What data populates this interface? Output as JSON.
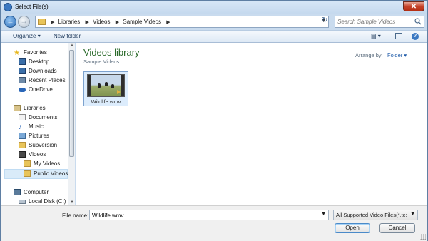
{
  "window": {
    "title": "Select File(s)"
  },
  "address": {
    "crumbs": [
      "Libraries",
      "Videos",
      "Sample Videos"
    ]
  },
  "search": {
    "placeholder": "Search Sample Videos"
  },
  "toolbar": {
    "organize": "Organize",
    "new_folder": "New folder"
  },
  "nav": {
    "favorites": {
      "label": "Favorites",
      "items": [
        "Desktop",
        "Downloads",
        "Recent Places",
        "OneDrive"
      ]
    },
    "libraries": {
      "label": "Libraries",
      "items": [
        "Documents",
        "Music",
        "Pictures",
        "Subversion",
        "Videos"
      ]
    },
    "videos_children": [
      "My Videos",
      "Public Videos"
    ],
    "computer": {
      "label": "Computer",
      "items": [
        "Local Disk (C:)"
      ]
    }
  },
  "content": {
    "title": "Videos library",
    "subtitle": "Sample Videos",
    "arrange_label": "Arrange by:",
    "arrange_value": "Folder",
    "files": [
      {
        "name": "Wildlife.wmv"
      }
    ]
  },
  "bottom": {
    "file_name_label": "File name:",
    "file_name_value": "Wildlife.wmv",
    "filter": "All Supported Video Files(*.tc;*.",
    "open": "Open",
    "cancel": "Cancel"
  },
  "colors": {
    "library_title": "#2a6a2a",
    "selection": "#d9ebf9",
    "link": "#1e5aa8"
  }
}
